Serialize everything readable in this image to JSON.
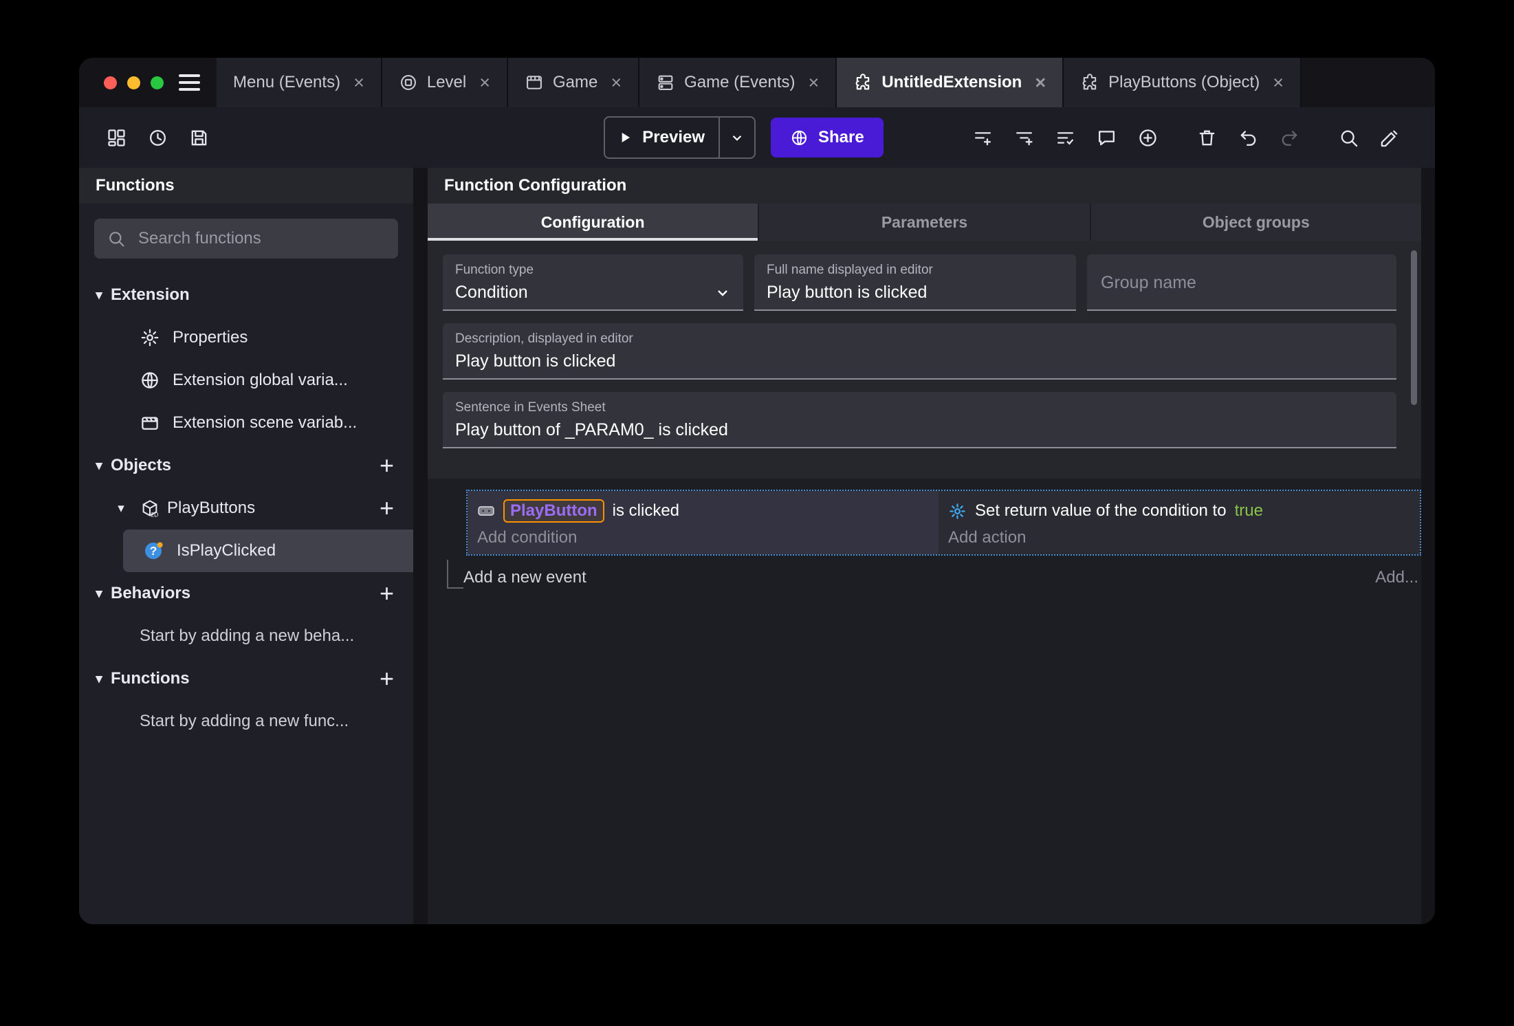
{
  "ui": {
    "close": "×",
    "caret_down": "▾",
    "plus": "+"
  },
  "tabs": [
    {
      "label": "Menu (Events)"
    },
    {
      "label": "Level"
    },
    {
      "label": "Game"
    },
    {
      "label": "Game (Events)"
    },
    {
      "label": "UntitledExtension"
    },
    {
      "label": "PlayButtons (Object)"
    }
  ],
  "toolbar": {
    "preview": "Preview",
    "share": "Share"
  },
  "sidebar": {
    "title": "Functions",
    "search_placeholder": "Search functions",
    "sections": {
      "extension": "Extension",
      "objects": "Objects",
      "behaviors": "Behaviors",
      "functions": "Functions"
    },
    "items": {
      "properties": "Properties",
      "global_vars": "Extension global varia...",
      "scene_vars": "Extension scene variab...",
      "playbuttons": "PlayButtons",
      "isplayclicked": "IsPlayClicked",
      "behaviors_hint": "Start by adding a new beha...",
      "functions_hint": "Start by adding a new func..."
    }
  },
  "main": {
    "title": "Function Configuration",
    "tabs": [
      {
        "label": "Configuration"
      },
      {
        "label": "Parameters"
      },
      {
        "label": "Object groups"
      }
    ],
    "form": {
      "function_type": {
        "label": "Function type",
        "value": "Condition"
      },
      "full_name": {
        "label": "Full name displayed in editor",
        "value": "Play button is clicked"
      },
      "group_name": {
        "placeholder": "Group name"
      },
      "description": {
        "label": "Description, displayed in editor",
        "value": "Play button is clicked"
      },
      "sentence": {
        "label": "Sentence in Events Sheet",
        "value": "Play button of _PARAM0_ is clicked"
      }
    },
    "events": {
      "condition": {
        "object": "PlayButton",
        "suffix": "is clicked",
        "add": "Add condition"
      },
      "action": {
        "text": "Set return value of the condition to",
        "value": "true",
        "add": "Add action"
      },
      "add_event": "Add a new event",
      "add_more": "Add..."
    }
  },
  "colors": {
    "accent_purple": "#4a1bd6",
    "selection_blue": "#4d8fd6",
    "object_purple": "#9b6cf6",
    "highlight_orange": "#ff9100",
    "true_green": "#8bc34a"
  }
}
